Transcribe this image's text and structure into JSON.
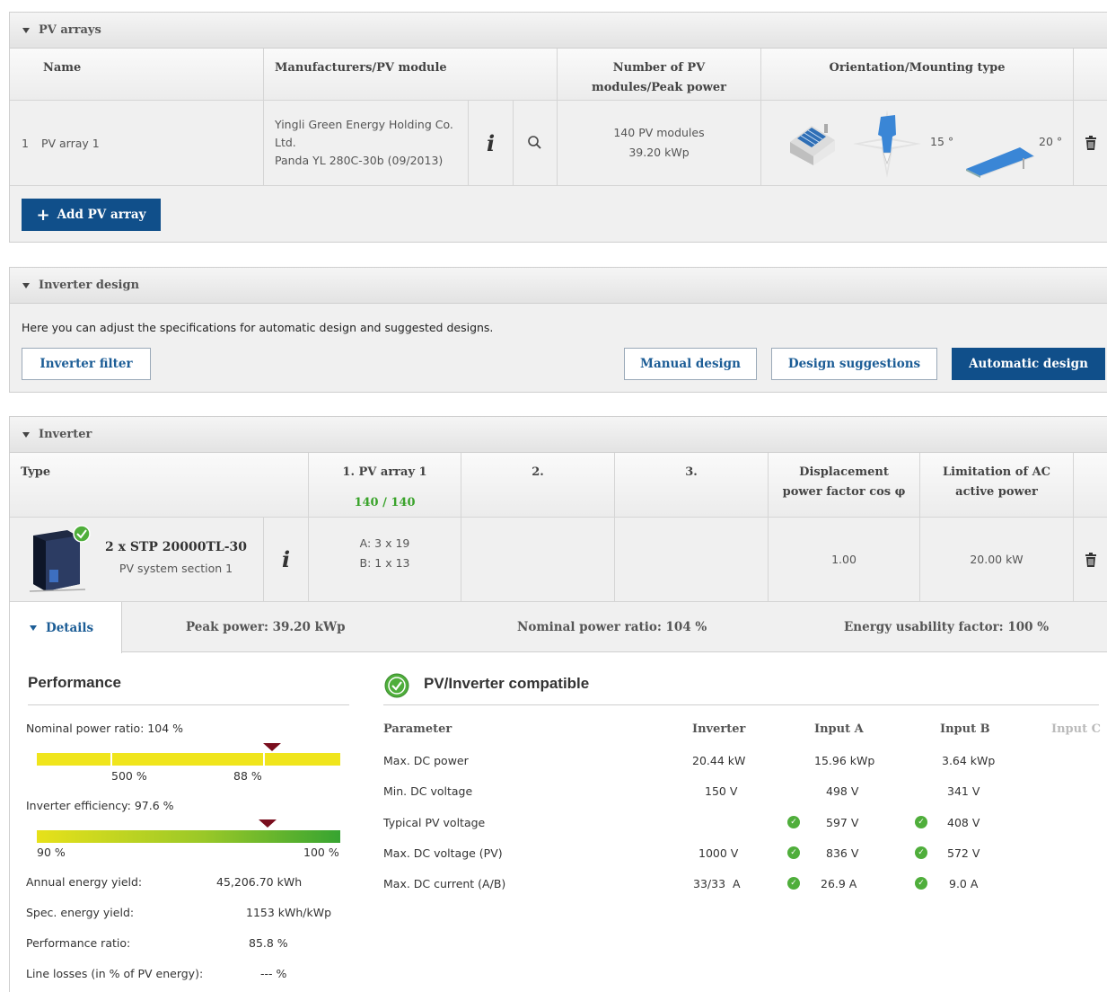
{
  "pv_arrays": {
    "section_title": "PV arrays",
    "headers": {
      "name": "Name",
      "module": "Manufacturers/PV module",
      "number": "Number of PV modules/Peak power",
      "orientation": "Orientation/Mounting type"
    },
    "rows": [
      {
        "index": "1",
        "name": "PV array 1",
        "manufacturer": "Yingli Green Energy Holding Co. Ltd.",
        "module": "Panda YL 280C-30b (09/2013)",
        "modules_count": "140 PV modules",
        "peak_power": "39.20 kWp",
        "azimuth": "15 °",
        "tilt": "20 °"
      }
    ],
    "add_button": "Add PV array"
  },
  "inverter_design": {
    "section_title": "Inverter design",
    "description": "Here you can adjust the specifications for automatic design and suggested designs.",
    "filter_button": "Inverter filter",
    "manual_button": "Manual design",
    "suggestions_button": "Design suggestions",
    "automatic_button": "Automatic design"
  },
  "inverter": {
    "section_title": "Inverter",
    "headers": {
      "type": "Type",
      "pv_array_1": "1. PV array 1",
      "pv_array_1_count": "140 / 140",
      "col2": "2.",
      "col3": "3.",
      "displacement": "Displacement power factor cos φ",
      "limitation": "Limitation of AC active power"
    },
    "row": {
      "model": "2 x STP 20000TL-30",
      "section": "PV system section 1",
      "input_a": "A: 3 x 19",
      "input_b": "B: 1 x 13",
      "cos_phi": "1.00",
      "ac_power": "20.00 kW"
    },
    "details_tab": "Details",
    "peak_power": "Peak power: 39.20 kWp",
    "nominal_ratio": "Nominal power ratio: 104 %",
    "usability": "Energy usability factor: 100 %"
  },
  "performance": {
    "title": "Performance",
    "nominal_label": "Nominal power ratio: 104 %",
    "nominal_marker": 0.775,
    "nominal_tick_1": "500 %",
    "nominal_tick_2": "88 %",
    "efficiency_label": "Inverter efficiency: 97.6 %",
    "efficiency_marker": 0.76,
    "eff_min": "90 %",
    "eff_max": "100 %",
    "stats": [
      {
        "label": "Annual energy yield:",
        "value": "45,206.70 kWh"
      },
      {
        "label": "Spec. energy yield:",
        "value": "1153 kWh/kWp"
      },
      {
        "label": "Performance ratio:",
        "value": "85.8 %"
      },
      {
        "label": "Line losses (in % of PV energy):",
        "value": "--- %"
      }
    ]
  },
  "compat": {
    "title": "PV/Inverter compatible",
    "headers": {
      "parameter": "Parameter",
      "inverter": "Inverter",
      "input_a": "Input A",
      "input_b": "Input B",
      "input_c": "Input C"
    },
    "rows": [
      {
        "parameter": "Max. DC power",
        "inverter": "20.44 kW",
        "a": "15.96 kWp",
        "b": "3.64 kWp",
        "check": false
      },
      {
        "parameter": "Min. DC voltage",
        "inverter": "150 V",
        "a": "498 V",
        "b": "341 V",
        "check": false
      },
      {
        "parameter": "Typical PV voltage",
        "inverter": "",
        "a": "597 V",
        "b": "408 V",
        "check": true
      },
      {
        "parameter": "Max. DC voltage (PV)",
        "inverter": "1000 V",
        "a": "836 V",
        "b": "572 V",
        "check": true
      },
      {
        "parameter": "Max. DC current (A/B)",
        "inverter": "33/33  A",
        "a": "26.9 A",
        "b": "9.0 A",
        "check": true
      }
    ]
  }
}
